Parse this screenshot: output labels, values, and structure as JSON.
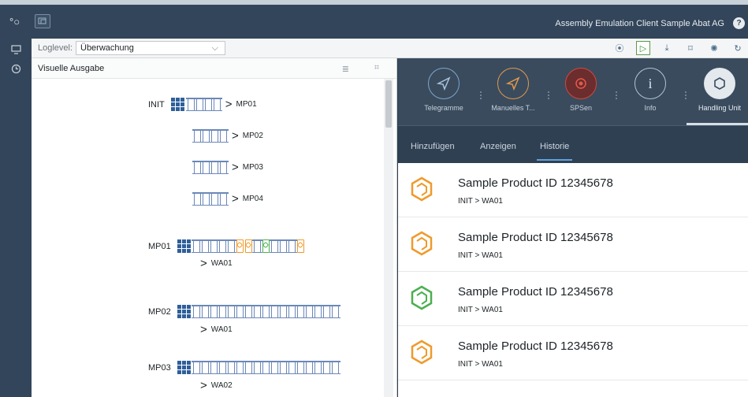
{
  "window": {
    "title": "Assembly Emulation Client Sample Abat AG",
    "help_label": "?"
  },
  "toolbar": {
    "loglevel_label": "Loglevel:",
    "loglevel_value": "Überwachung"
  },
  "left_panel": {
    "title": "Visuelle Ausgabe",
    "init_label": "INIT",
    "init_routes": [
      "MP01",
      "MP02",
      "MP03",
      "MP04"
    ],
    "mp_rows": [
      {
        "label": "MP01",
        "dest": "WA01"
      },
      {
        "label": "MP02",
        "dest": "WA01"
      },
      {
        "label": "MP03",
        "dest": "WA02"
      }
    ]
  },
  "right_panel": {
    "cards": [
      {
        "label": "Telegramme",
        "icon": "paper-plane-icon",
        "color": "#7fa6c8"
      },
      {
        "label": "Manuelles T...",
        "icon": "paper-plane-icon",
        "color": "#e29a4a"
      },
      {
        "label": "SPSen",
        "icon": "plc-icon",
        "color": "#d04a3c"
      },
      {
        "label": "Info",
        "icon": "info-icon",
        "color": "#b4c4d4"
      },
      {
        "label": "Handling Unit",
        "icon": "hexagon-icon",
        "color": "#dfe6ec"
      }
    ],
    "tabs": [
      "Hinzufügen",
      "Anzeigen",
      "Historie"
    ],
    "active_tab": "Historie",
    "history": [
      {
        "title": "Sample Product ID 12345678",
        "route": "INIT > WA01",
        "color": "#ef9a2b"
      },
      {
        "title": "Sample Product ID 12345678",
        "route": "INIT > WA01",
        "color": "#ef9a2b"
      },
      {
        "title": "Sample Product ID 12345678",
        "route": "INIT > WA01",
        "color": "#4caf50"
      },
      {
        "title": "Sample Product ID 12345678",
        "route": "INIT > WA01",
        "color": "#ef9a2b"
      }
    ]
  }
}
